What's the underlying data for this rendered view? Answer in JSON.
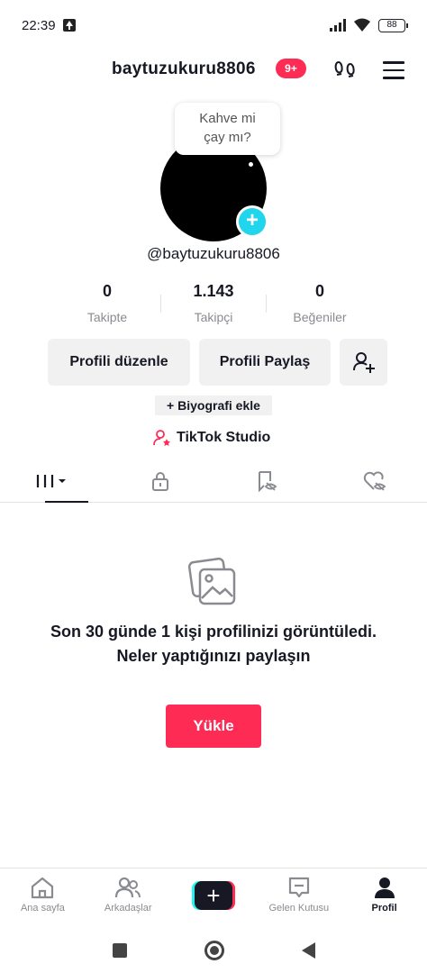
{
  "status_bar": {
    "time": "22:39",
    "battery": "88"
  },
  "header": {
    "username": "baytuzukuru8806",
    "notification_badge": "9+"
  },
  "profile": {
    "bubble_text": "Kahve mi\nçay mı?",
    "handle": "@baytuzukuru8806",
    "stats": [
      {
        "value": "0",
        "label": "Takipte"
      },
      {
        "value": "1.143",
        "label": "Takipçi"
      },
      {
        "value": "0",
        "label": "Beğeniler"
      }
    ],
    "buttons": {
      "edit": "Profili düzenle",
      "share": "Profili Paylaş"
    },
    "bio_add": "+ Biyografi ekle",
    "studio": "TikTok Studio"
  },
  "tabs": [
    {
      "icon": "grid-icon",
      "active": true
    },
    {
      "icon": "lock-icon"
    },
    {
      "icon": "eye-off-icon"
    },
    {
      "icon": "heart-off-icon"
    }
  ],
  "empty_state": {
    "icon": "image-icon",
    "message": "Son 30 günde 1 kişi profilinizi görüntüledi. Neler yaptığınızı paylaşın",
    "button": "Yükle"
  },
  "bottom_nav": [
    {
      "label": "Ana sayfa",
      "icon": "home-icon"
    },
    {
      "label": "Arkadaşlar",
      "icon": "friends-icon"
    },
    {
      "label": "",
      "icon": "create-icon"
    },
    {
      "label": "Gelen Kutusu",
      "icon": "inbox-icon"
    },
    {
      "label": "Profil",
      "icon": "profile-icon",
      "active": true
    }
  ],
  "colors": {
    "accent": "#fe2c55",
    "cyan": "#20d5ec"
  }
}
